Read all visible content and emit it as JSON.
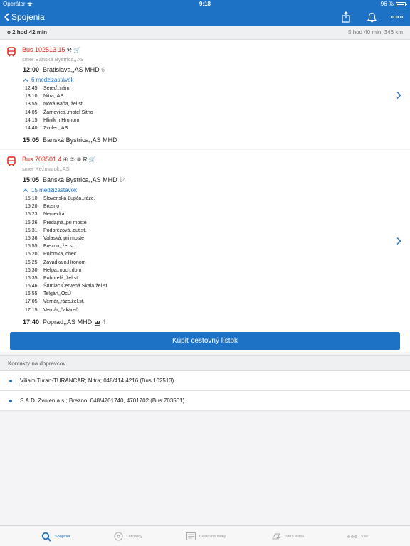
{
  "status": {
    "carrier": "Operátor",
    "time": "9:18",
    "battery": "96 %"
  },
  "nav": {
    "back_label": "Spojenia"
  },
  "summary": {
    "duration": "o 2 hod 42 min",
    "total": "5 hod 40 min, 346 km"
  },
  "connections": [
    {
      "line": "Bus 102513 15",
      "symbols": "⚒ 🛒",
      "direction": "smer Banská Bystrica,,AS",
      "from": {
        "time": "12:00",
        "stop": "Bratislava,,AS MHD",
        "platform": "6"
      },
      "stops_label": "6 medzizastávok",
      "stops": [
        {
          "time": "12:45",
          "name": "Sereď,,nám."
        },
        {
          "time": "13:10",
          "name": "Nitra,,AS"
        },
        {
          "time": "13:55",
          "name": "Nová Baňa,,žel.st."
        },
        {
          "time": "14:05",
          "name": "Žarnovica,,motel Sitno"
        },
        {
          "time": "14:15",
          "name": "Hliník n.Hronom"
        },
        {
          "time": "14:40",
          "name": "Zvolen,,AS"
        }
      ],
      "to": {
        "time": "15:05",
        "stop": "Banská Bystrica,,AS MHD",
        "platform": ""
      }
    },
    {
      "line": "Bus 703501 4",
      "symbols": "④ ⑤ ⑥ R 🛒",
      "direction": "smer Kežmarok,,AS",
      "from": {
        "time": "15:05",
        "stop": "Banská Bystrica,,AS MHD",
        "platform": "14"
      },
      "stops_label": "15 medzizastávok",
      "stops": [
        {
          "time": "15:10",
          "name": "Slovenská Ľupča,,rázc."
        },
        {
          "time": "15:20",
          "name": "Brusno"
        },
        {
          "time": "15:23",
          "name": "Nemecká"
        },
        {
          "time": "15:26",
          "name": "Predajná,,pri moste"
        },
        {
          "time": "15:31",
          "name": "Podbrezová,,aut.st."
        },
        {
          "time": "15:36",
          "name": "Valaská,,pri moste"
        },
        {
          "time": "15:55",
          "name": "Brezno,,žel.st."
        },
        {
          "time": "16:20",
          "name": "Polomka,,obec"
        },
        {
          "time": "16:25",
          "name": "Závadka n.Hronom"
        },
        {
          "time": "16:30",
          "name": "Heľpa,,obch.dom"
        },
        {
          "time": "16:35",
          "name": "Pohorelá,,žel.st."
        },
        {
          "time": "16:46",
          "name": "Šumiac,Červená Skala,žel.st."
        },
        {
          "time": "16:55",
          "name": "Telgárt,,OcÚ"
        },
        {
          "time": "17:05",
          "name": "Vernár,,rázc.žel.st."
        },
        {
          "time": "17:15",
          "name": "Vernár,,čakáreň"
        }
      ],
      "to": {
        "time": "17:40",
        "stop": "Poprad,,AS MHD",
        "platform": "4"
      }
    }
  ],
  "buy_button": "Kúpiť cestovný lístok",
  "contacts_header": "Kontakty na dopravcov",
  "contacts": [
    "Viliam Turan-TURANCAR; Nitra; 048/414 4216 (Bus 102513)",
    "S.A.D. Zvolen a.s.; Brezno; 048/4701740, 4701702 (Bus 703501)"
  ],
  "tabs": [
    {
      "label": "Spojenia",
      "icon": "search-icon",
      "active": true
    },
    {
      "label": "Odchody",
      "icon": "clock-icon",
      "active": false
    },
    {
      "label": "Cestovné lístky",
      "icon": "ticket-icon",
      "active": false
    },
    {
      "label": "SMS lístok",
      "icon": "sms-ticket-icon",
      "active": false
    },
    {
      "label": "Viac",
      "icon": "more-icon",
      "active": false
    }
  ],
  "colors": {
    "accent": "#1d72c6",
    "bus_red": "#e2231a"
  }
}
